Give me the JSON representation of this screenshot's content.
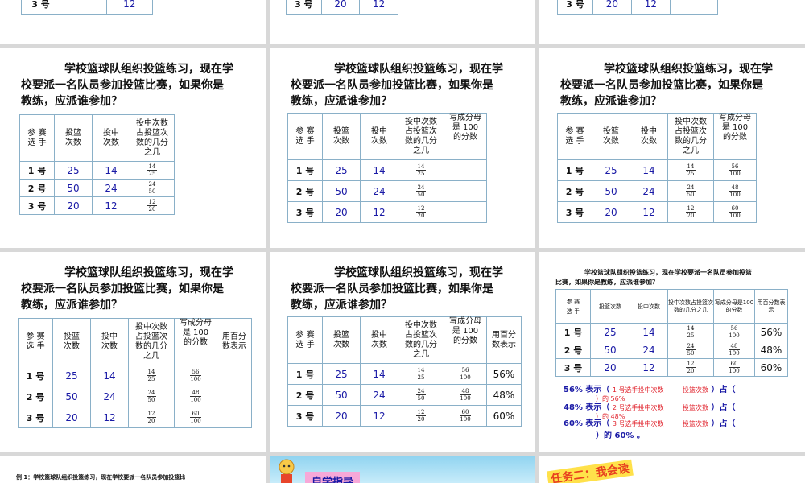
{
  "question_lines": [
    "学校篮球队组织投篮练习，现在学",
    "校要派一名队员参加投篮比赛，如果你是",
    "教练，应派谁参加？"
  ],
  "small_question_lines": [
    "学校篮球队组织投篮练习，现在学校要派一名队员参加投篮",
    "比赛，如果你是教练，应派谁参加？"
  ],
  "headers": {
    "player": "参 赛\n选 手",
    "attempts": "投篮\n次数",
    "made": "投中\n次数",
    "fraction": "投中次数\n占投篮次\n数的几分\n之几",
    "hundredths": "写成分母\n是 100\n的分数",
    "percent": "用百分\n数表示"
  },
  "small_headers": {
    "attempts": "投篮次数",
    "made": "投中次数",
    "fraction": "投中次数占投篮次数的几分之几",
    "hundredths": "写成分母是100 的分数",
    "percent": "用百分数表示"
  },
  "rows": [
    {
      "label": "1 号",
      "attempts": "25",
      "made": "14",
      "fn": "14",
      "fd": "25",
      "hn": "56",
      "hd": "100",
      "pct": "56%"
    },
    {
      "label": "2 号",
      "attempts": "50",
      "made": "24",
      "fn": "24",
      "fd": "50",
      "hn": "48",
      "hd": "100",
      "pct": "48%"
    },
    {
      "label": "3 号",
      "attempts": "20",
      "made": "12",
      "fn": "12",
      "fd": "20",
      "hn": "60",
      "hd": "100",
      "pct": "60%"
    }
  ],
  "top_row": {
    "label": "3 号",
    "attempts": "20",
    "made": "12"
  },
  "explanations": [
    {
      "pct": "56%",
      "word": "表示（",
      "red1": "1 号选手投中次数",
      "mid": "投篮次数",
      "end": "）占（",
      "red2": "）的 56%"
    },
    {
      "pct": "48%",
      "word": "表示（",
      "red1": "2 号选手投中次数",
      "mid": "投篮次数",
      "end": "）占（",
      "red2": "）的 48%"
    },
    {
      "pct": "60%",
      "word": "表示（",
      "red1": "3 号选手投中次数",
      "mid": "投篮次数",
      "end": "）占（",
      "red2": "）的 60% 。"
    }
  ],
  "bottom": {
    "example": "例 1：学校篮球队组织投篮练习，现在学校要派一名队员参加投篮比",
    "guide": "自学指导",
    "task": "任务二：我会读"
  }
}
